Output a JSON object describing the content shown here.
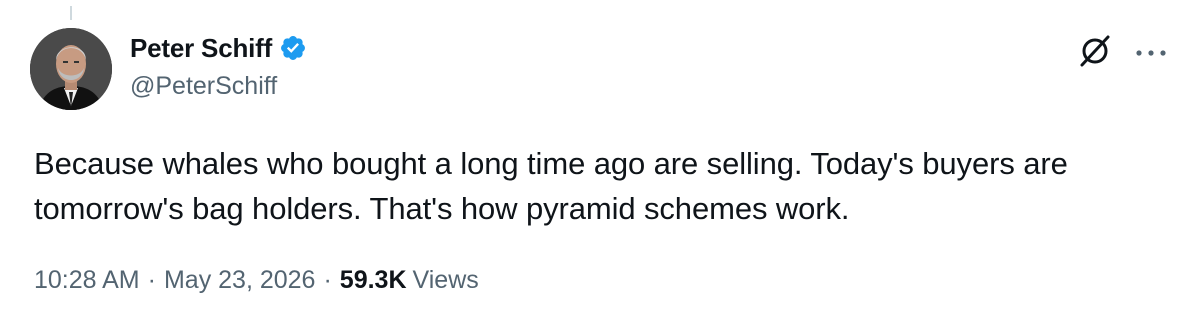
{
  "tweet": {
    "author": {
      "display_name": "Peter Schiff",
      "handle": "@PeterSchiff",
      "verified": true,
      "avatar_icon": "profile-photo"
    },
    "text": "Because whales who bought a long time ago are selling. Today's buyers are tomorrow's bag holders. That's how pyramid schemes work.",
    "time": "10:28 AM",
    "date": "May 23, 2026",
    "separator": "·",
    "views_count": "59.3K",
    "views_label": "Views"
  },
  "icons": {
    "grok": "grok-icon",
    "more": "more-icon",
    "verified": "verified-badge-icon"
  },
  "colors": {
    "verified_blue": "#1d9bf0",
    "secondary_text": "#536471",
    "primary_text": "#0f1419"
  }
}
